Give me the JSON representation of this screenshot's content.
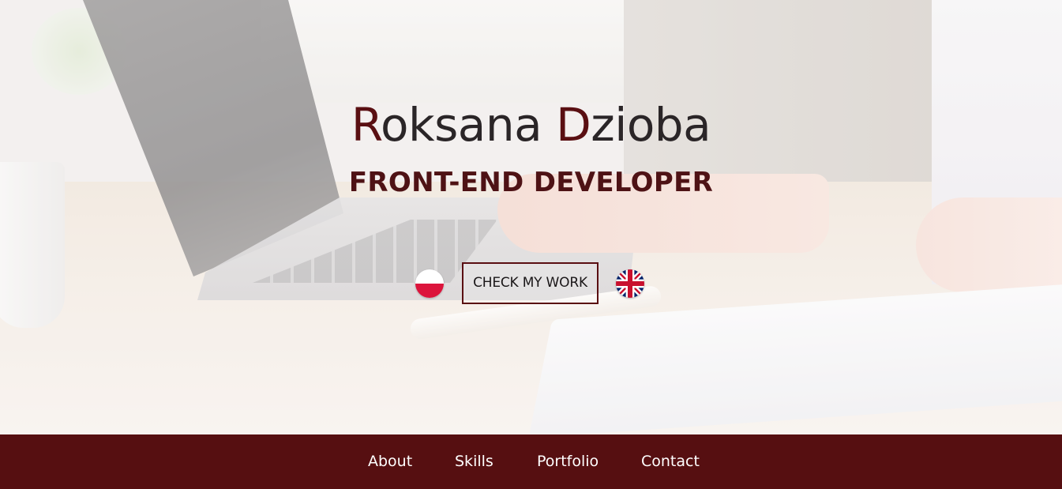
{
  "hero": {
    "name_first_initial": "R",
    "name_first_rest": "oksana ",
    "name_last_initial": "D",
    "name_last_rest": "zioba",
    "role": "FRONT-END DEVELOPER",
    "cta_label": "CHECK MY WORK",
    "languages": [
      {
        "icon": "poland-flag-icon"
      },
      {
        "icon": "uk-flag-icon"
      }
    ]
  },
  "nav": {
    "items": [
      {
        "label": "About"
      },
      {
        "label": "Skills"
      },
      {
        "label": "Portfolio"
      },
      {
        "label": "Contact"
      }
    ]
  },
  "colors": {
    "accent": "#5a0f12",
    "navbar_bg": "#560f11",
    "nav_text": "#ffffff",
    "title_text": "#2a2527"
  }
}
